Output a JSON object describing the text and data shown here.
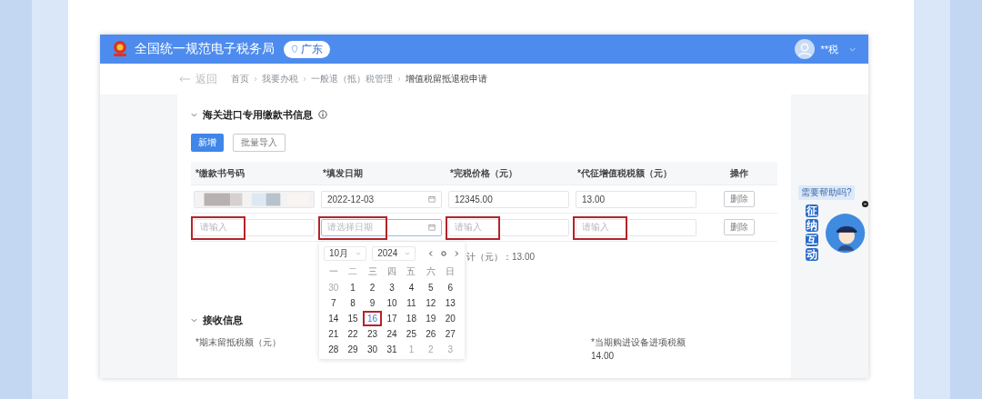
{
  "header": {
    "title": "全国统一规范电子税务局",
    "region": "广东",
    "user": "**税"
  },
  "breadcrumb": {
    "back": "返回",
    "items": [
      "首页",
      "我要办税",
      "一般退（抵）税管理",
      "增值税留抵退税申请"
    ]
  },
  "section1": {
    "title": "海关进口专用缴款书信息",
    "expanded": true
  },
  "buttons": [
    {
      "label": "新增",
      "kind": "primary"
    },
    {
      "label": "批量导入",
      "kind": "outline"
    }
  ],
  "table": {
    "columns": [
      "*缴款书号码",
      "*填发日期",
      "*完税价格（元）",
      "*代征增值税税额（元）",
      "操作"
    ],
    "rows": [
      {
        "cells": [
          {
            "kind": "redacted"
          },
          {
            "kind": "date",
            "value": "2022-12-03",
            "highlighted": false
          },
          {
            "kind": "text",
            "value": "12345.00",
            "highlighted": false
          },
          {
            "kind": "text",
            "value": "13.00",
            "highlighted": false
          }
        ],
        "action": "删除"
      },
      {
        "cells": [
          {
            "kind": "text",
            "placeholder": "请输入",
            "highlighted": true
          },
          {
            "kind": "date",
            "placeholder": "请选择日期",
            "highlighted": true
          },
          {
            "kind": "text",
            "placeholder": "请输入",
            "highlighted": true
          },
          {
            "kind": "text",
            "placeholder": "请输入",
            "highlighted": true
          }
        ],
        "action": "删除"
      }
    ]
  },
  "total": "计（元）：13.00",
  "calendar": {
    "month": "10月",
    "year": "2024",
    "weekdays": [
      "一",
      "二",
      "三",
      "四",
      "五",
      "六",
      "日"
    ],
    "days": [
      {
        "day": "30",
        "muted": true,
        "highlighted": false
      },
      {
        "day": "1",
        "muted": false,
        "highlighted": false
      },
      {
        "day": "2",
        "muted": false,
        "highlighted": false
      },
      {
        "day": "3",
        "muted": false,
        "highlighted": false
      },
      {
        "day": "4",
        "muted": false,
        "highlighted": false
      },
      {
        "day": "5",
        "muted": false,
        "highlighted": false
      },
      {
        "day": "6",
        "muted": false,
        "highlighted": false
      },
      {
        "day": "7",
        "muted": false,
        "highlighted": false
      },
      {
        "day": "8",
        "muted": false,
        "highlighted": false
      },
      {
        "day": "9",
        "muted": false,
        "highlighted": false
      },
      {
        "day": "10",
        "muted": false,
        "highlighted": false
      },
      {
        "day": "11",
        "muted": false,
        "highlighted": false
      },
      {
        "day": "12",
        "muted": false,
        "highlighted": false
      },
      {
        "day": "13",
        "muted": false,
        "highlighted": false
      },
      {
        "day": "14",
        "muted": false,
        "highlighted": false
      },
      {
        "day": "15",
        "muted": false,
        "highlighted": false
      },
      {
        "day": "16",
        "muted": false,
        "highlighted": true
      },
      {
        "day": "17",
        "muted": false,
        "highlighted": false
      },
      {
        "day": "18",
        "muted": false,
        "highlighted": false
      },
      {
        "day": "19",
        "muted": false,
        "highlighted": false
      },
      {
        "day": "20",
        "muted": false,
        "highlighted": false
      },
      {
        "day": "21",
        "muted": false,
        "highlighted": false
      },
      {
        "day": "22",
        "muted": false,
        "highlighted": false
      },
      {
        "day": "23",
        "muted": false,
        "highlighted": false
      },
      {
        "day": "24",
        "muted": false,
        "highlighted": false
      },
      {
        "day": "25",
        "muted": false,
        "highlighted": false
      },
      {
        "day": "26",
        "muted": false,
        "highlighted": false
      },
      {
        "day": "27",
        "muted": false,
        "highlighted": false
      },
      {
        "day": "28",
        "muted": false,
        "highlighted": false
      },
      {
        "day": "29",
        "muted": false,
        "highlighted": false
      },
      {
        "day": "30",
        "muted": false,
        "highlighted": false
      },
      {
        "day": "31",
        "muted": false,
        "highlighted": false
      },
      {
        "day": "1",
        "muted": true,
        "highlighted": false
      },
      {
        "day": "2",
        "muted": true,
        "highlighted": false
      },
      {
        "day": "3",
        "muted": true,
        "highlighted": false
      }
    ]
  },
  "section2": {
    "title": "接收信息",
    "expanded": true
  },
  "fields": [
    {
      "label": "*期末留抵税额（元）"
    },
    {
      "label": "*当期购进设备进项税额",
      "value": "14.00"
    }
  ],
  "assistant": {
    "bubble": "需要帮助吗?",
    "label": "征纳互动"
  }
}
